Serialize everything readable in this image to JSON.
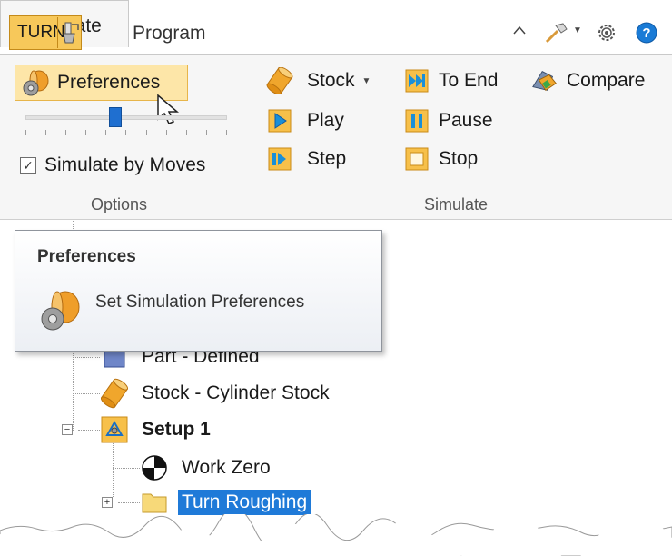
{
  "tabs": {
    "app_label": "TURN",
    "program": "Program",
    "simulate": "Simulate"
  },
  "ribbon": {
    "options_group": {
      "preferences_label": "Preferences",
      "simulate_by_moves_label": "Simulate by Moves",
      "simulate_by_moves_checked": true,
      "group_label": "Options"
    },
    "simulate_group": {
      "stock_label": "Stock",
      "play_label": "Play",
      "step_label": "Step",
      "to_end_label": "To End",
      "pause_label": "Pause",
      "stop_label": "Stop",
      "compare_label": "Compare",
      "group_label": "Simulate"
    }
  },
  "tooltip": {
    "title": "Preferences",
    "description": "Set Simulation Preferences"
  },
  "tree": {
    "part": "Part - Defined",
    "stock": "Stock - Cylinder Stock",
    "setup": "Setup 1",
    "work_zero": "Work Zero",
    "turn_roughing": "Turn Roughing"
  },
  "colors": {
    "accent": "#1f7ad8",
    "hover_fill": "#fde6a8",
    "app_button": "#f7c85a",
    "play_blue": "#1a8fd8"
  }
}
